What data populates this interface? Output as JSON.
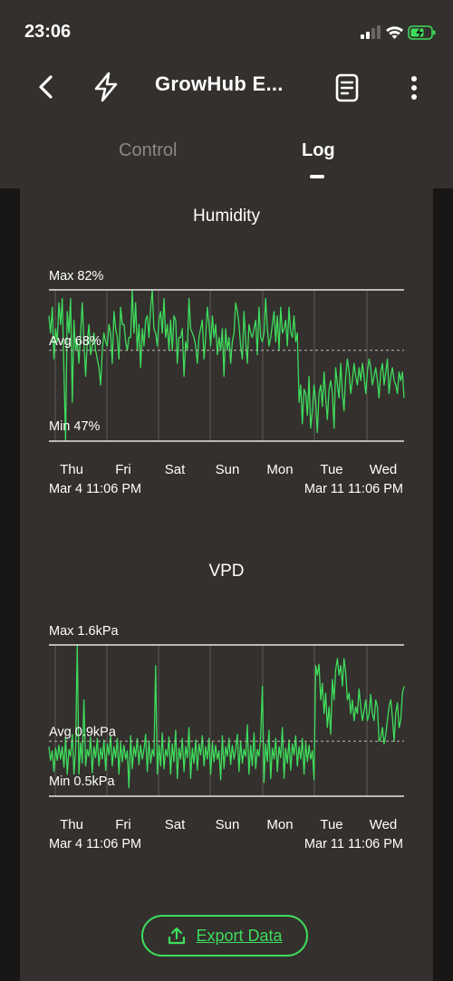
{
  "status_bar": {
    "time": "23:06"
  },
  "nav": {
    "title": "GrowHub E..."
  },
  "tabs": [
    {
      "label": "Control",
      "active": false
    },
    {
      "label": "Log",
      "active": true
    }
  ],
  "days": [
    "Thu",
    "Fri",
    "Sat",
    "Sun",
    "Mon",
    "Tue",
    "Wed"
  ],
  "range": {
    "start": "Mar 4 11:06 PM",
    "end": "Mar 11 11:06 PM"
  },
  "colors": {
    "series": "#3fdc5c",
    "background": "#33302d",
    "accent": "#3fdc5c"
  },
  "icons": [
    "back-chevron-icon",
    "lightning-icon",
    "document-icon",
    "more-vertical-icon",
    "upload-icon"
  ],
  "export": {
    "label": "Export Data"
  },
  "chart_data": [
    {
      "type": "line",
      "title": "Humidity",
      "unit": "%",
      "max_label": "Max 82%",
      "avg_label": "Avg 68%",
      "min_label": "Min 47%",
      "ylim": [
        47,
        82
      ],
      "avg": 68,
      "x_start": "Mar 4 11:06 PM",
      "x_end": "Mar 11 11:06 PM",
      "categories": [
        "Thu",
        "Fri",
        "Sat",
        "Sun",
        "Mon",
        "Tue",
        "Wed"
      ],
      "series": [
        {
          "values": [
            76,
            72,
            78,
            66,
            73,
            70,
            79,
            74,
            80,
            63,
            47,
            77,
            72,
            80,
            56,
            75,
            68,
            70,
            65,
            72,
            79,
            70,
            62,
            70,
            74,
            67,
            69,
            72,
            68,
            66,
            64,
            60,
            68,
            72,
            70,
            69,
            74,
            72,
            65,
            77,
            73,
            71,
            66,
            78,
            74,
            74,
            70,
            68,
            71,
            71,
            82,
            72,
            79,
            68,
            74,
            64,
            73,
            69,
            75,
            76,
            71,
            78,
            82,
            73,
            72,
            69,
            75,
            77,
            72,
            80,
            71,
            74,
            68,
            75,
            68,
            76,
            75,
            65,
            71,
            71,
            73,
            62,
            70,
            68,
            80,
            73,
            72,
            71,
            69,
            65,
            71,
            73,
            75,
            66,
            71,
            78,
            74,
            69,
            76,
            71,
            74,
            67,
            71,
            68,
            73,
            62,
            73,
            68,
            71,
            65,
            70,
            72,
            79,
            77,
            74,
            69,
            66,
            77,
            70,
            65,
            74,
            72,
            71,
            73,
            75,
            67,
            78,
            71,
            70,
            72,
            80,
            73,
            69,
            71,
            74,
            77,
            70,
            76,
            68,
            78,
            72,
            73,
            75,
            69,
            78,
            72,
            71,
            76,
            70,
            72,
            56,
            60,
            51,
            59,
            58,
            53,
            62,
            50,
            54,
            60,
            56,
            49,
            58,
            60,
            55,
            63,
            57,
            52,
            59,
            61,
            58,
            50,
            64,
            60,
            57,
            65,
            58,
            54,
            62,
            66,
            63,
            58,
            61,
            65,
            62,
            60,
            64,
            61,
            65,
            62,
            58,
            63,
            66,
            64,
            60,
            62,
            64,
            61,
            57,
            63,
            65,
            60,
            63,
            66,
            58,
            62,
            64,
            61,
            60,
            58,
            63,
            61,
            63,
            57
          ]
        }
      ]
    },
    {
      "type": "line",
      "title": "VPD",
      "unit": "kPa",
      "max_label": "Max 1.6kPa",
      "avg_label": "Avg 0.9kPa",
      "min_label": "Min 0.5kPa",
      "ylim": [
        0.5,
        1.6
      ],
      "avg": 0.9,
      "x_start": "Mar 4 11:06 PM",
      "x_end": "Mar 11 11:06 PM",
      "categories": [
        "Thu",
        "Fri",
        "Sat",
        "Sun",
        "Mon",
        "Tue",
        "Wed"
      ],
      "series": [
        {
          "values": [
            0.86,
            0.76,
            0.83,
            0.68,
            0.85,
            0.76,
            0.87,
            0.77,
            0.86,
            0.71,
            0.93,
            0.66,
            0.84,
            0.79,
            0.95,
            0.66,
            0.83,
            1.6,
            0.66,
            0.89,
            0.74,
            1.2,
            0.72,
            0.84,
            0.79,
            0.93,
            0.67,
            0.86,
            0.78,
            0.92,
            0.72,
            0.85,
            0.77,
            0.91,
            0.69,
            0.88,
            0.8,
            0.94,
            0.72,
            0.86,
            0.78,
            0.92,
            0.66,
            0.89,
            0.75,
            0.87,
            0.77,
            0.83,
            0.56,
            0.94,
            0.7,
            0.86,
            0.79,
            0.92,
            0.73,
            0.87,
            0.77,
            0.84,
            0.95,
            0.68,
            0.9,
            0.74,
            0.84,
            0.79,
            1.45,
            0.66,
            0.87,
            0.72,
            0.96,
            0.7,
            0.84,
            0.79,
            0.93,
            0.66,
            0.88,
            0.75,
            0.98,
            0.63,
            0.85,
            0.77,
            0.92,
            0.68,
            0.86,
            0.78,
            1.0,
            0.63,
            0.85,
            0.74,
            0.91,
            0.69,
            0.88,
            0.8,
            0.94,
            0.72,
            0.86,
            0.77,
            0.92,
            0.66,
            0.89,
            0.75,
            0.87,
            0.77,
            0.83,
            0.62,
            0.94,
            0.7,
            0.86,
            0.79,
            0.92,
            0.73,
            0.87,
            0.77,
            0.84,
            0.95,
            0.68,
            0.9,
            0.74,
            0.84,
            0.79,
            1.02,
            0.66,
            0.87,
            0.72,
            0.96,
            0.7,
            0.84,
            0.79,
            0.93,
            1.3,
            0.6,
            0.88,
            0.75,
            0.98,
            0.63,
            0.85,
            0.77,
            0.92,
            0.68,
            0.86,
            0.78,
            1.0,
            0.63,
            0.85,
            0.74,
            0.91,
            0.69,
            0.88,
            0.8,
            0.94,
            0.72,
            0.86,
            0.77,
            0.92,
            0.66,
            0.89,
            0.75,
            0.87,
            0.77,
            0.83,
            0.62,
            1.45,
            1.38,
            1.46,
            1.2,
            1.32,
            1.1,
            1.25,
            1.0,
            1.15,
            0.95,
            1.35,
            1.2,
            1.42,
            1.5,
            1.38,
            1.45,
            1.3,
            1.5,
            1.4,
            1.2,
            1.25,
            1.1,
            1.2,
            1.05,
            1.15,
            1.1,
            1.28,
            1.15,
            1.05,
            1.12,
            1.2,
            1.05,
            1.1,
            1.24,
            1.1,
            1.05,
            1.2,
            1.15,
            0.9,
            0.92,
            1.0,
            0.88,
            0.95,
            1.05,
            1.15,
            1.2,
            1.08,
            0.9,
            1.1,
            1.18,
            1.0,
            1.05,
            1.25,
            1.3
          ]
        }
      ]
    }
  ]
}
